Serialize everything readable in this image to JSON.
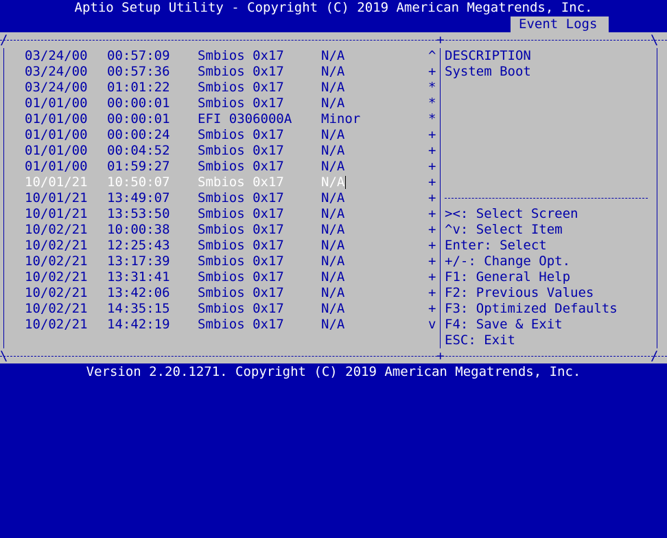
{
  "title": "Aptio Setup Utility - Copyright (C) 2019 American Megatrends, Inc.",
  "tab_label": "Event Logs",
  "footer": "Version 2.20.1271. Copyright (C) 2019 American Megatrends, Inc.",
  "log_rows": [
    {
      "date": "03/24/00",
      "time": "00:57:09",
      "type": "Smbios 0x17",
      "severity": "N/A",
      "mark": "^"
    },
    {
      "date": "03/24/00",
      "time": "00:57:36",
      "type": "Smbios 0x17",
      "severity": "N/A",
      "mark": "+"
    },
    {
      "date": "03/24/00",
      "time": "01:01:22",
      "type": "Smbios 0x17",
      "severity": "N/A",
      "mark": "*"
    },
    {
      "date": "01/01/00",
      "time": "00:00:01",
      "type": "Smbios 0x17",
      "severity": "N/A",
      "mark": "*"
    },
    {
      "date": "01/01/00",
      "time": "00:00:01",
      "type": "EFI 0306000A",
      "severity": "Minor",
      "mark": "*"
    },
    {
      "date": "01/01/00",
      "time": "00:00:24",
      "type": "Smbios 0x17",
      "severity": "N/A",
      "mark": "+"
    },
    {
      "date": "01/01/00",
      "time": "00:04:52",
      "type": "Smbios 0x17",
      "severity": "N/A",
      "mark": "+"
    },
    {
      "date": "01/01/00",
      "time": "01:59:27",
      "type": "Smbios 0x17",
      "severity": "N/A",
      "mark": "+"
    },
    {
      "date": "10/01/21",
      "time": "10:50:07",
      "type": "Smbios 0x17",
      "severity": "N/A",
      "mark": "+"
    },
    {
      "date": "10/01/21",
      "time": "13:49:07",
      "type": "Smbios 0x17",
      "severity": "N/A",
      "mark": "+"
    },
    {
      "date": "10/01/21",
      "time": "13:53:50",
      "type": "Smbios 0x17",
      "severity": "N/A",
      "mark": "+"
    },
    {
      "date": "10/02/21",
      "time": "10:00:38",
      "type": "Smbios 0x17",
      "severity": "N/A",
      "mark": "+"
    },
    {
      "date": "10/02/21",
      "time": "12:25:43",
      "type": "Smbios 0x17",
      "severity": "N/A",
      "mark": "+"
    },
    {
      "date": "10/02/21",
      "time": "13:17:39",
      "type": "Smbios 0x17",
      "severity": "N/A",
      "mark": "+"
    },
    {
      "date": "10/02/21",
      "time": "13:31:41",
      "type": "Smbios 0x17",
      "severity": "N/A",
      "mark": "+"
    },
    {
      "date": "10/02/21",
      "time": "13:42:06",
      "type": "Smbios 0x17",
      "severity": "N/A",
      "mark": "+"
    },
    {
      "date": "10/02/21",
      "time": "14:35:15",
      "type": "Smbios 0x17",
      "severity": "N/A",
      "mark": "+"
    },
    {
      "date": "10/02/21",
      "time": "14:42:19",
      "type": "Smbios 0x17",
      "severity": "N/A",
      "mark": "v"
    }
  ],
  "selected_index": 8,
  "description": {
    "heading": "DESCRIPTION",
    "text": "System Boot"
  },
  "help_lines": [
    "><: Select Screen",
    "^v: Select Item",
    "Enter: Select",
    "+/-: Change Opt.",
    "F1: General Help",
    "F2: Previous Values",
    "F3: Optimized Defaults",
    "F4: Save & Exit",
    "ESC: Exit"
  ],
  "colors": {
    "background": "#0000aa",
    "panel": "#c0c0c0",
    "text": "#0000aa",
    "highlight_text": "#ffffff"
  }
}
